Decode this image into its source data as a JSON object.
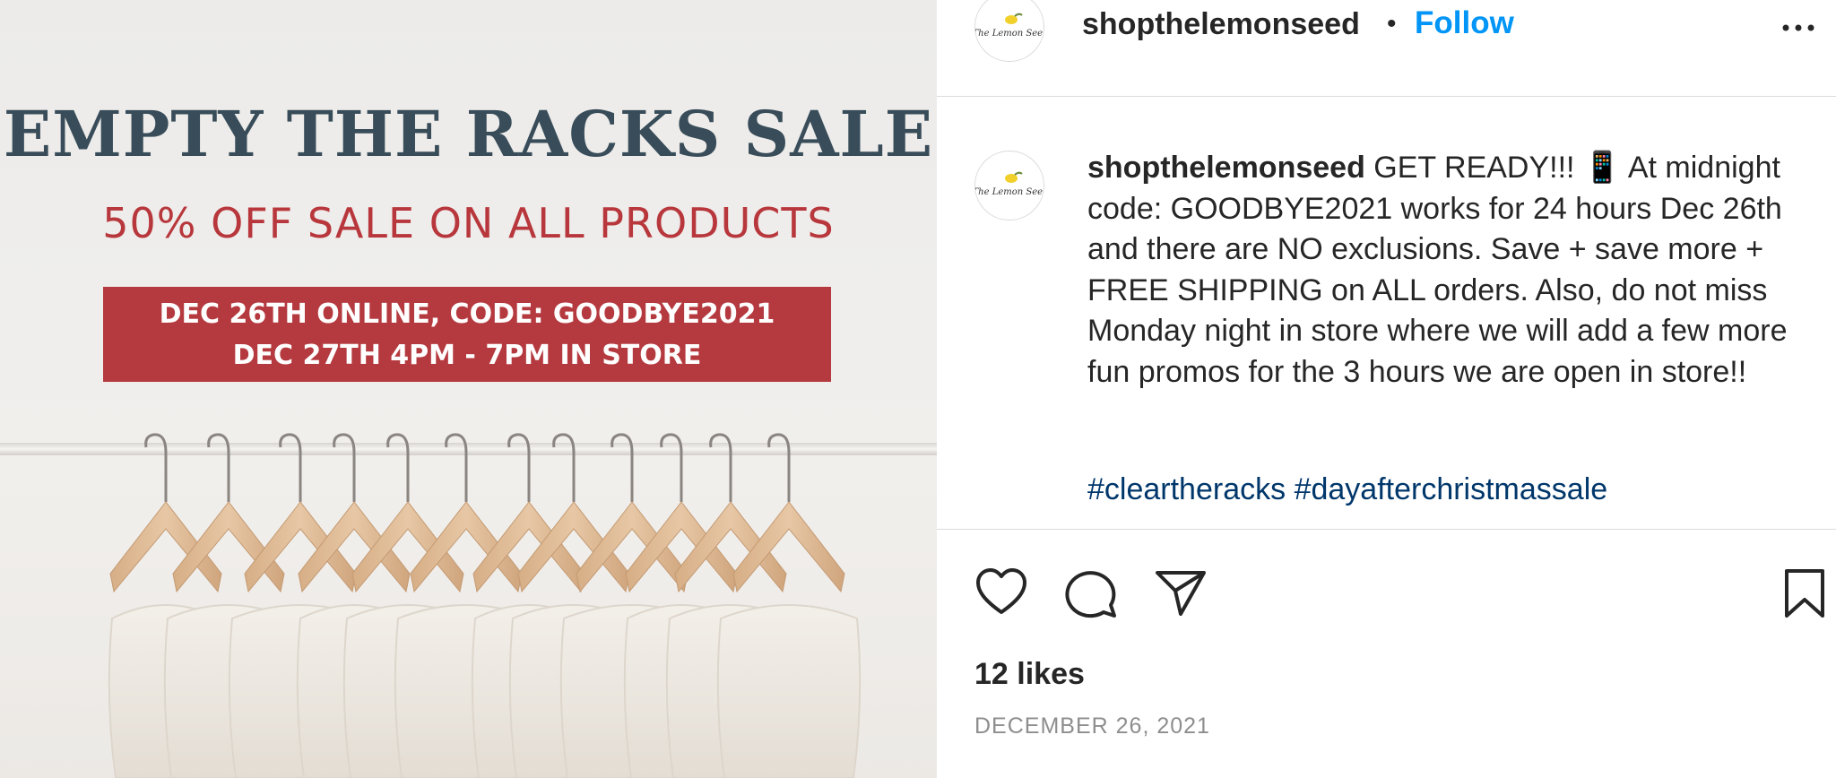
{
  "post_image": {
    "title": "EMPTY THE RACKS SALE",
    "subtitle": "50% OFF SALE ON ALL PRODUCTS",
    "banner_line1": "DEC 26TH ONLINE, CODE: GOODBYE2021",
    "banner_line2": "DEC 27TH 4PM - 7PM IN STORE",
    "colors": {
      "title": "#384c59",
      "subtitle": "#b8373c",
      "banner_bg": "#b53a3f"
    }
  },
  "header": {
    "username": "shopthelemonseed",
    "separator": "•",
    "follow_label": "Follow",
    "more_icon": "more-horizontal-icon",
    "avatar_text": "The Lemon Seed"
  },
  "caption": {
    "username": "shopthelemonseed",
    "text": "GET READY!!! 📱 At midnight code: GOODBYE2021 works for 24 hours Dec 26th and there are NO exclusions. Save + save more + FREE SHIPPING on ALL orders. Also, do not miss Monday night in store where we will add a few more fun promos for the 3 hours we are open in store!!",
    "dots_line1": "⠀⠀⠀⠀⠀⠀⠀⠀",
    "dots_line2": "⠀⠀⠀⠀⠀⠀⠀⠀",
    "hashtag1": "#cleartheracks",
    "hashtag2": "#dayafterchristmassale"
  },
  "actions": {
    "like_icon": "heart-icon",
    "comment_icon": "comment-icon",
    "share_icon": "send-icon",
    "save_icon": "bookmark-icon"
  },
  "likes": "12 likes",
  "date": "DECEMBER 26, 2021",
  "colors": {
    "link": "#0095f6",
    "hashtag": "#00376b",
    "muted": "#8e8e8e",
    "border": "#dbdbdb"
  }
}
